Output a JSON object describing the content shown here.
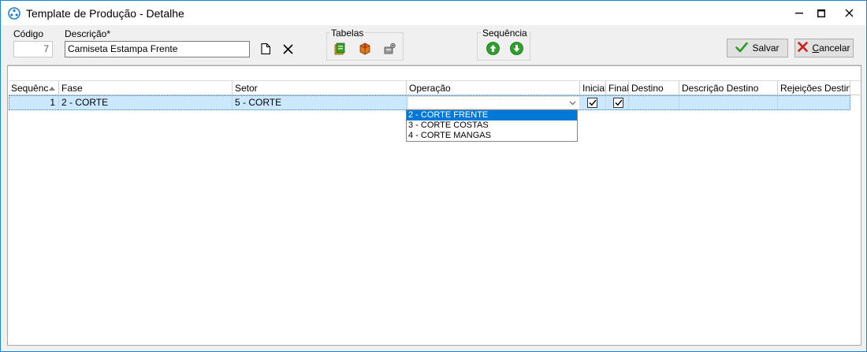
{
  "window": {
    "title": "Template de Produção - Detalhe",
    "accent": "#1883d7"
  },
  "form": {
    "codigo_label": "Código",
    "codigo_value": "7",
    "descricao_label": "Descrição*",
    "descricao_value": "Camiseta Estampa Frente"
  },
  "groups": {
    "tabelas_title": "Tabelas",
    "sequencia_title": "Sequência"
  },
  "actions": {
    "salvar_label": "Salvar",
    "cancelar_first": "C",
    "cancelar_rest": "ancelar"
  },
  "grid": {
    "columns": [
      "Sequênc",
      "Fase",
      "Setor",
      "Operação",
      "Inicial",
      "Final",
      "Destino",
      "Descrição Destino",
      "Rejeições Destino"
    ],
    "rows": [
      {
        "sequencia": "1",
        "fase": "2 - CORTE",
        "setor": "5 - CORTE",
        "operacao": "",
        "inicial": true,
        "final": true,
        "destino": "",
        "descricao_destino": "",
        "rejeicoes_destino": ""
      }
    ],
    "selected_row_color": "#cce8ff"
  },
  "dropdown": {
    "options": [
      "2 - CORTE FRENTE",
      "3 - CORTE COSTAS",
      "4 - CORTE MANGAS"
    ],
    "selected_index": 0,
    "highlight_color": "#0078d7"
  }
}
